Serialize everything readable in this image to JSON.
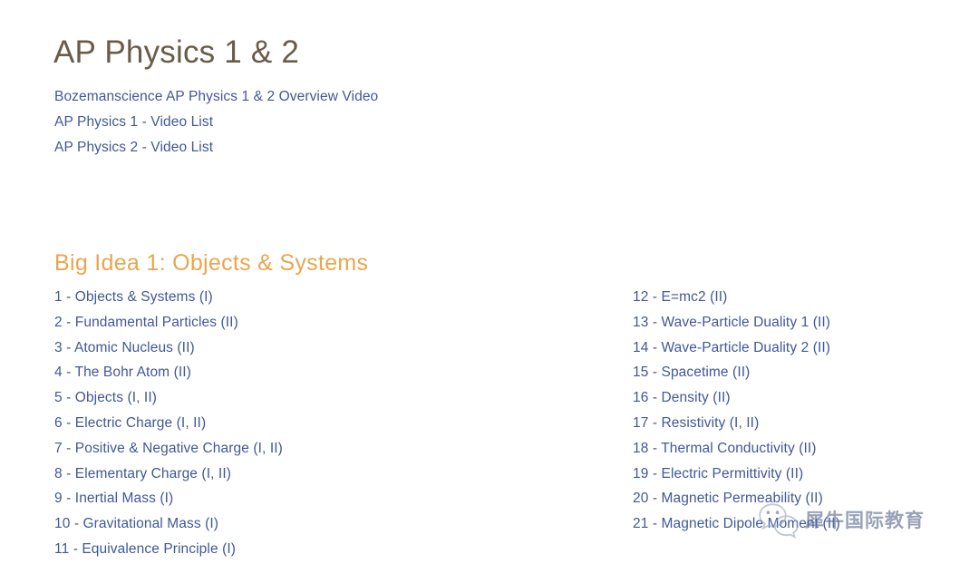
{
  "page": {
    "title": "AP Physics 1 & 2",
    "background_color": "#ffffff",
    "title_color": "#6b5b49",
    "link_color": "#3f5896",
    "heading_color": "#e9a64e"
  },
  "intro_links": [
    {
      "label": "Bozemanscience AP Physics 1 & 2 Overview Video"
    },
    {
      "label": "AP Physics 1 - Video List"
    },
    {
      "label": "AP Physics 2 - Video List"
    }
  ],
  "section": {
    "heading": "Big Idea 1:  Objects & Systems"
  },
  "topics": {
    "left_column": [
      {
        "label": "1 - Objects & Systems (I)"
      },
      {
        "label": "2 - Fundamental Particles (II)"
      },
      {
        "label": "3 - Atomic Nucleus (II)"
      },
      {
        "label": "4 - The Bohr Atom (II)"
      },
      {
        "label": "5 - Objects (I, II)"
      },
      {
        "label": "6 - Electric Charge (I, II)"
      },
      {
        "label": "7 - Positive & Negative Charge (I, II)"
      },
      {
        "label": "8 - Elementary Charge (I, II)"
      },
      {
        "label": "9 - Inertial Mass (I)"
      },
      {
        "label": "10 - Gravitational Mass (I)"
      },
      {
        "label": "11 - Equivalence Principle (I)"
      }
    ],
    "right_column": [
      {
        "label": "12 - E=mc2 (II)"
      },
      {
        "label": "13 - Wave-Particle Duality 1 (II)"
      },
      {
        "label": "14 - Wave-Particle Duality 2 (II)"
      },
      {
        "label": "15 - Spacetime (II)"
      },
      {
        "label": "16 - Density (II)"
      },
      {
        "label": "17 - Resistivity (I, II)"
      },
      {
        "label": "18 - Thermal Conductivity (II)"
      },
      {
        "label": "19 - Electric Permittivity (II)"
      },
      {
        "label": "20 - Magnetic Permeability (II)"
      },
      {
        "label": "21 - Magnetic Dipole Moment (II)"
      }
    ]
  },
  "watermark": {
    "icon": "wechat-icon",
    "text": "犀牛国际教育",
    "color": "#5a6a90"
  }
}
